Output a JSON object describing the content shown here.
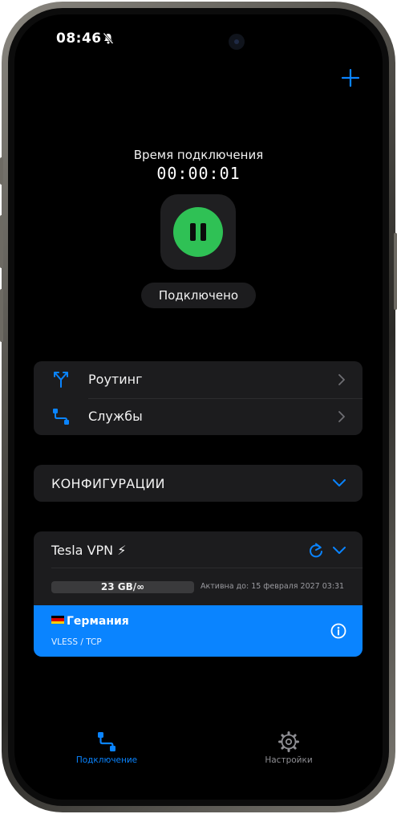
{
  "status_bar": {
    "time": "08:46"
  },
  "connection": {
    "time_label": "Время подключения",
    "timer": "00:00:01",
    "status": "Подключено"
  },
  "menu": {
    "items": [
      {
        "label": "Роутинг",
        "icon": "routing-icon"
      },
      {
        "label": "Службы",
        "icon": "services-icon"
      }
    ]
  },
  "configurations": {
    "label": "КОНФИГУРАЦИИ"
  },
  "vpn": {
    "name": "Tesla VPN ⚡",
    "traffic": "23 GB/∞",
    "expiry": "Активна до: 15 февраля 2027 03:31",
    "server": {
      "name": "Германия",
      "protocol": "VLESS / TCP"
    }
  },
  "tabs": [
    {
      "label": "Подключение",
      "active": true
    },
    {
      "label": "Настройки",
      "active": false
    }
  ],
  "colors": {
    "accent": "#0a84ff",
    "connected": "#2fc155",
    "card": "#1c1c1e",
    "background": "#000000"
  }
}
